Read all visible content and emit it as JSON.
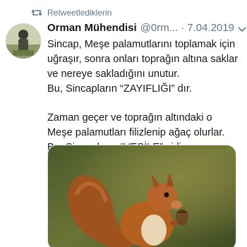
{
  "retweet": {
    "label": "Retweetlediklerin",
    "icon": "retweet-icon",
    "color": "#657786"
  },
  "tweet": {
    "display_name": "Orman Mühendisi",
    "handle": "@0rm...",
    "separator": "·",
    "date": "7.04.2019",
    "lines": [
      "Sincap, Meşe palamutlarını toplamak için",
      "uğraşır, sonra onları toprağın altına saklar",
      "ve nereye sakladığını unutur.",
      "Bu, Sincapların “ZAYIFLIĞI” dır.",
      "",
      "Zaman geçer ve toprağın altındaki o",
      "Meşe palamutları filizlenip ağaç olurlar.",
      "Bu, Sincapların “VESİLE” sidir."
    ],
    "menu_icon": "chevron-down-icon",
    "avatar_icon": "avatar",
    "media_icon": "squirrel-photo"
  },
  "colors": {
    "text": "#14171a",
    "secondary": "#657786"
  }
}
